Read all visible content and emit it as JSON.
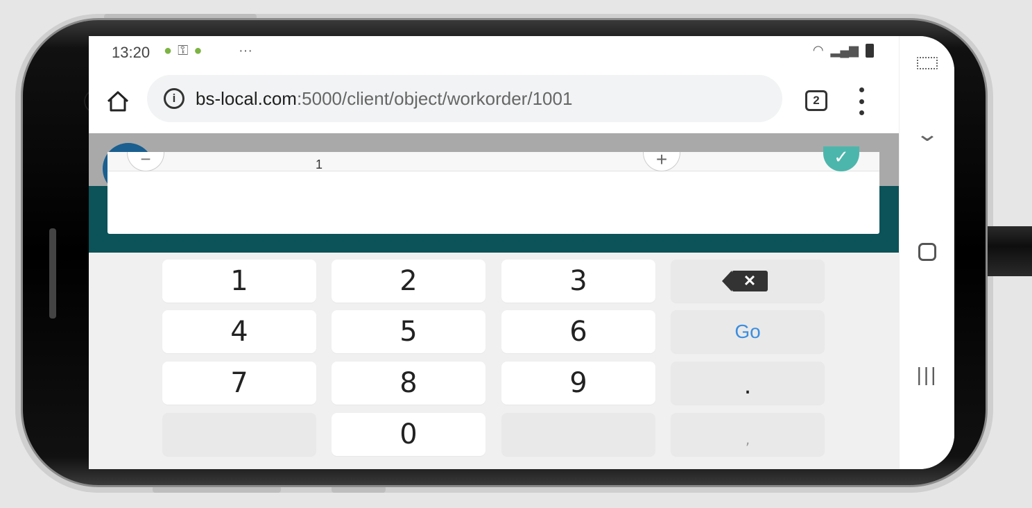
{
  "status_bar": {
    "time": "13:20",
    "left_icons": "android-icon, key-icon, android-icon",
    "overflow": "···",
    "right_icons": "wifi, signal, battery"
  },
  "browser": {
    "url_host": "bs-local.com",
    "url_path": ":5000/client/object/workorder/1001",
    "tab_count": "2"
  },
  "quantity_editor": {
    "minus": "−",
    "value": "1",
    "plus": "+",
    "confirm": "✓"
  },
  "keypad": {
    "rows": [
      [
        "1",
        "2",
        "3",
        "backspace"
      ],
      [
        "4",
        "5",
        "6",
        "Go"
      ],
      [
        "7",
        "8",
        "9",
        "."
      ],
      [
        "",
        "0",
        "",
        ","
      ]
    ],
    "go_label": "Go",
    "dot_label": ".",
    "comma_label": ","
  },
  "nav": {
    "items": [
      "keyboard-icon",
      "chevron-down-icon",
      "home-icon",
      "recents-icon"
    ]
  },
  "colors": {
    "teal": "#0b5358",
    "go_blue": "#3b8de0",
    "confirm_teal": "#4db6ac"
  }
}
